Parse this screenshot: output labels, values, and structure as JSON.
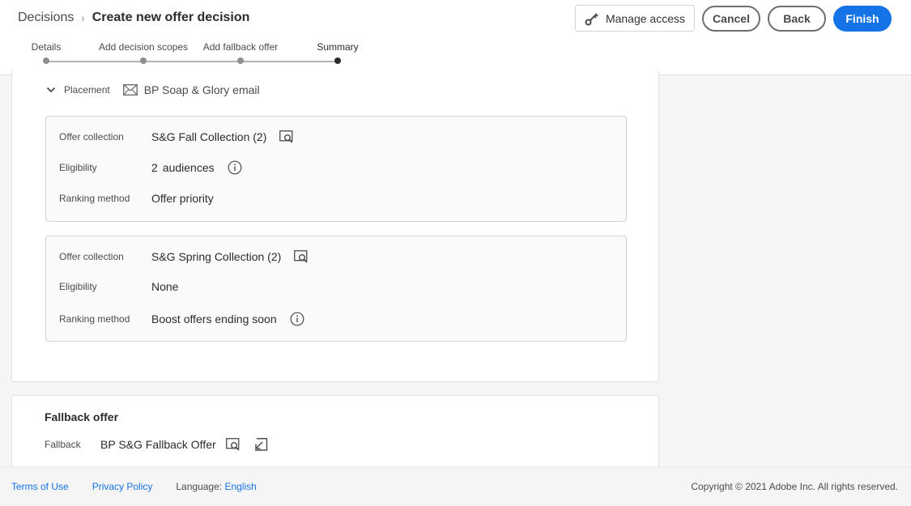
{
  "breadcrumb": {
    "parent": "Decisions",
    "separator": "›",
    "current": "Create new offer decision"
  },
  "actions": {
    "manage_access": "Manage access",
    "cancel": "Cancel",
    "back": "Back",
    "finish": "Finish"
  },
  "steps": [
    {
      "label": "Details",
      "state": "completed"
    },
    {
      "label": "Add decision scopes",
      "state": "completed"
    },
    {
      "label": "Add fallback offer",
      "state": "completed"
    },
    {
      "label": "Summary",
      "state": "current"
    }
  ],
  "placement": {
    "label": "Placement",
    "value": "BP Soap & Glory email",
    "icon": "envelope-icon"
  },
  "collections": [
    {
      "offer_collection_label": "Offer collection",
      "offer_collection": "S&G Fall Collection (2)",
      "eligibility_label": "Eligibility",
      "eligibility_count": "2",
      "eligibility": "audiences",
      "ranking_label": "Ranking method",
      "ranking": "Offer priority"
    },
    {
      "offer_collection_label": "Offer collection",
      "offer_collection": "S&G Spring Collection (2)",
      "eligibility_label": "Eligibility",
      "eligibility": "None",
      "ranking_label": "Ranking method",
      "ranking": "Boost offers ending soon"
    }
  ],
  "fallback": {
    "title": "Fallback offer",
    "label": "Fallback",
    "value": "BP S&G Fallback Offer"
  },
  "footer": {
    "terms": "Terms of Use",
    "privacy": "Privacy Policy",
    "language_label": "Language:",
    "language": "English",
    "copyright": "Copyright ©  2021 Adobe Inc.  All rights reserved."
  },
  "colors": {
    "accent": "#1473e6",
    "text": "#2c2c2c",
    "muted": "#4b4b4b"
  }
}
